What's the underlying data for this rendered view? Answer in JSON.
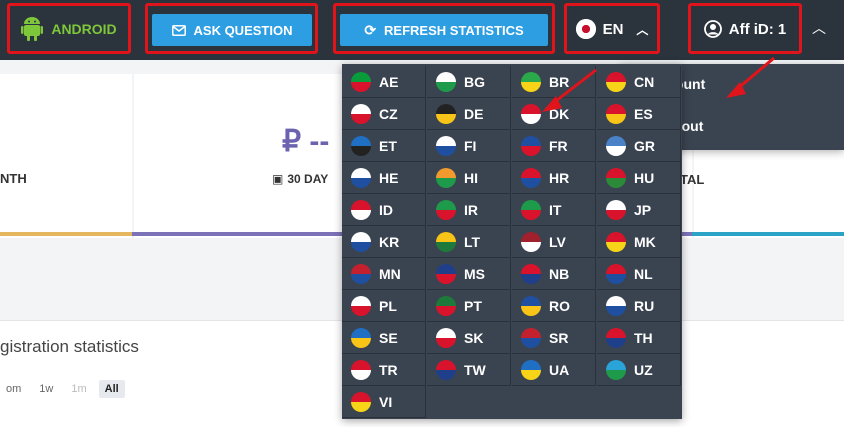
{
  "topbar": {
    "android_label": "ANDROID",
    "ask_label": "ASK QUESTION",
    "refresh_label": "REFRESH STATISTICS",
    "lang_label": "EN",
    "aff_label": "Aff iD: 1"
  },
  "stats": {
    "month_label": "NTH",
    "currency": "₽ --",
    "days_label": "30 DAY",
    "total_label": "TAL"
  },
  "registration": {
    "title": "gistration statistics",
    "filters": [
      "om",
      "1w",
      "1m",
      "All"
    ]
  },
  "user_menu": {
    "account": "Account",
    "logout": "Log out"
  },
  "languages": [
    {
      "code": "AE",
      "c1": "#0a9c3a",
      "c2": "#d8132b"
    },
    {
      "code": "BG",
      "c1": "#ffffff",
      "c2": "#1e9b4a"
    },
    {
      "code": "BR",
      "c1": "#2aa84a",
      "c2": "#f7d417"
    },
    {
      "code": "CN",
      "c1": "#d8132b",
      "c2": "#f7d417"
    },
    {
      "code": "CZ",
      "c1": "#ffffff",
      "c2": "#d8132b"
    },
    {
      "code": "DE",
      "c1": "#222222",
      "c2": "#f7c417"
    },
    {
      "code": "DK",
      "c1": "#d8132b",
      "c2": "#ffffff"
    },
    {
      "code": "ES",
      "c1": "#d8132b",
      "c2": "#f7c417"
    },
    {
      "code": "ET",
      "c1": "#1f6fc4",
      "c2": "#222222"
    },
    {
      "code": "FI",
      "c1": "#ffffff",
      "c2": "#1f4fa0"
    },
    {
      "code": "FR",
      "c1": "#1f4fa0",
      "c2": "#d8132b"
    },
    {
      "code": "GR",
      "c1": "#4a82c8",
      "c2": "#ffffff"
    },
    {
      "code": "HE",
      "c1": "#ffffff",
      "c2": "#1f4fa0"
    },
    {
      "code": "HI",
      "c1": "#f29a2e",
      "c2": "#1e9b4a"
    },
    {
      "code": "HR",
      "c1": "#d8132b",
      "c2": "#1f4fa0"
    },
    {
      "code": "HU",
      "c1": "#d8132b",
      "c2": "#2a8a3a"
    },
    {
      "code": "ID",
      "c1": "#d8132b",
      "c2": "#ffffff"
    },
    {
      "code": "IR",
      "c1": "#1e9b4a",
      "c2": "#d8132b"
    },
    {
      "code": "IT",
      "c1": "#1e9b4a",
      "c2": "#d8132b"
    },
    {
      "code": "JP",
      "c1": "#ffffff",
      "c2": "#d8132b"
    },
    {
      "code": "KR",
      "c1": "#ffffff",
      "c2": "#1f4fa0"
    },
    {
      "code": "LT",
      "c1": "#f7c417",
      "c2": "#1e7a3a"
    },
    {
      "code": "LV",
      "c1": "#a0202d",
      "c2": "#ffffff"
    },
    {
      "code": "MK",
      "c1": "#d8132b",
      "c2": "#f7d417"
    },
    {
      "code": "MN",
      "c1": "#c4202d",
      "c2": "#1f4fa0"
    },
    {
      "code": "MS",
      "c1": "#1f3f8a",
      "c2": "#d8132b"
    },
    {
      "code": "NB",
      "c1": "#d8132b",
      "c2": "#1f3f8a"
    },
    {
      "code": "NL",
      "c1": "#d8132b",
      "c2": "#1f4fa0"
    },
    {
      "code": "PL",
      "c1": "#ffffff",
      "c2": "#d8132b"
    },
    {
      "code": "PT",
      "c1": "#1e7a3a",
      "c2": "#d8132b"
    },
    {
      "code": "RO",
      "c1": "#1f4fa0",
      "c2": "#f7c417"
    },
    {
      "code": "RU",
      "c1": "#ffffff",
      "c2": "#1f4fa0"
    },
    {
      "code": "SE",
      "c1": "#1f6fc4",
      "c2": "#f7c417"
    },
    {
      "code": "SK",
      "c1": "#ffffff",
      "c2": "#d8132b"
    },
    {
      "code": "SR",
      "c1": "#c4202d",
      "c2": "#1f4fa0"
    },
    {
      "code": "TH",
      "c1": "#d8132b",
      "c2": "#1f3f8a"
    },
    {
      "code": "TR",
      "c1": "#d8132b",
      "c2": "#ffffff"
    },
    {
      "code": "TW",
      "c1": "#d8132b",
      "c2": "#1f3f8a"
    },
    {
      "code": "UA",
      "c1": "#1f6fc4",
      "c2": "#f7d417"
    },
    {
      "code": "UZ",
      "c1": "#2aa3d8",
      "c2": "#1e9b4a"
    },
    {
      "code": "VI",
      "c1": "#d8132b",
      "c2": "#f7d417"
    }
  ]
}
